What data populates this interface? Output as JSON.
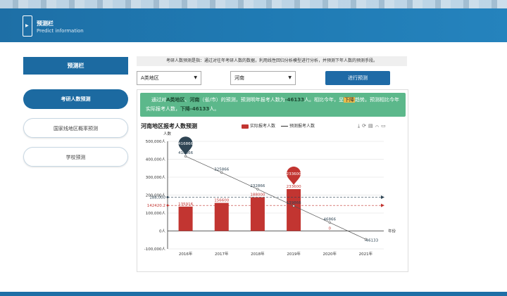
{
  "header": {
    "title": "预测栏",
    "subtitle": "Predict information"
  },
  "sidebar": {
    "heading": "预测栏",
    "items": [
      {
        "label": "考研人数预测",
        "active": true
      },
      {
        "label": "国家线地区概率预测",
        "active": false
      },
      {
        "label": "学校预测",
        "active": false
      }
    ]
  },
  "notice": "考研人数预测是指：通过对往年考研人数的数据，利用线性回归分析模型进行分析，并预测下年人数的预测手段。",
  "filters": {
    "region": "A类地区",
    "province": "河南",
    "predict_label": "进行预测"
  },
  "result": {
    "p1": "通过对",
    "region": "A类地区",
    "p2": "、",
    "province": "河南",
    "p3": "（省/市）的预测，预测明年报考人数为",
    "value": "-46133",
    "p4": "人。相比今年，呈",
    "trend": "下降",
    "p5": "趋势。预测相比今年实际报考人数，",
    "p6": "下降",
    "delta": "-46133",
    "p7": "人。"
  },
  "chart_data": {
    "type": "bar",
    "title": "河南地区报考人数预测",
    "ylabel": "人数",
    "xlabel": "年份",
    "categories": [
      "2016年",
      "2017年",
      "2018年",
      "2019年",
      "2020年",
      "2021年"
    ],
    "ylim": [
      -100000,
      500000
    ],
    "yticks": [
      "-100,000人",
      "0人",
      "100,000人",
      "200,000人",
      "300,000人",
      "400,000人",
      "500,000人"
    ],
    "series": [
      {
        "name": "实际报考人数",
        "type": "bar",
        "color": "#c23531",
        "values": [
          135916,
          156600,
          188000,
          233600,
          0,
          null
        ]
      },
      {
        "name": "预测报考人数",
        "type": "line",
        "color": "#555555",
        "values": [
          416866,
          325866,
          232866,
          139866,
          46866,
          -46133
        ]
      }
    ],
    "bar_labels": [
      "135916",
      "156600",
      "188000",
      "233600",
      "0",
      ""
    ],
    "line_labels": [
      "416866",
      "325866",
      "232866",
      "139866",
      "46866",
      "-46133"
    ],
    "max_pin": {
      "label": "416866",
      "color": "#2f4554"
    },
    "bar_max_pin": {
      "label": "233600",
      "color": "#c23531"
    },
    "mark_lines": [
      {
        "label": "188,000",
        "value": 188000,
        "color": "#2f4554"
      },
      {
        "label": "142420.2",
        "value": 142420.2,
        "color": "#c23531"
      }
    ],
    "legend_position": "top-center",
    "grid": true
  }
}
